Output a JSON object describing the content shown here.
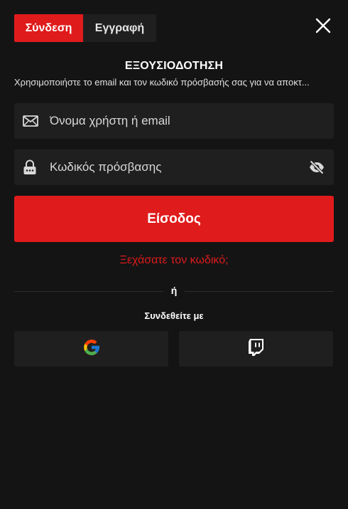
{
  "tabs": {
    "login_label": "Σύνδεση",
    "register_label": "Εγγραφή"
  },
  "close_icon": "close-icon",
  "heading": "ΕΞΟΥΣΙΟΔΟΤΗΣΗ",
  "subtitle": "Χρησιμοποιήστε το email και τον κωδικό πρόσβασής σας για να αποκτ...",
  "form": {
    "username_placeholder": "Όνομα χρήστη ή email",
    "username_icon": "envelope-icon",
    "password_placeholder": "Κωδικός πρόσβασης",
    "password_icon": "lock-icon",
    "toggle_visibility_icon": "eye-off-icon",
    "submit_label": "Είσοδος",
    "forgot_label": "Ξεχάσατε τον κωδικό;"
  },
  "divider_text": "ή",
  "social": {
    "label": "Συνδεθείτε με",
    "providers": [
      "google-icon",
      "twitch-icon"
    ]
  },
  "colors": {
    "background": "#141415",
    "panel": "#1f1f20",
    "accent": "#e01b1b",
    "text": "#ffffff"
  }
}
